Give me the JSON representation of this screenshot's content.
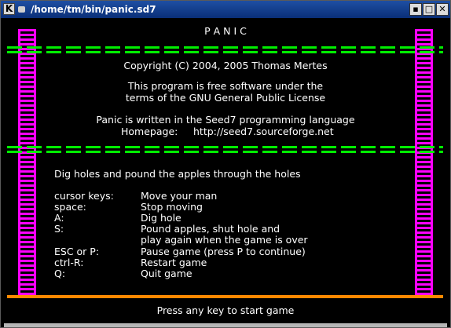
{
  "window": {
    "title": "/home/tm/bin/panic.sd7"
  },
  "icons": {
    "app": "K",
    "min": "▪",
    "max": "□",
    "close": "✕"
  },
  "game": {
    "title": "P A N I C",
    "copyright": "Copyright (C) 2004, 2005  Thomas Mertes",
    "license1": "This program is free software under the",
    "license2": "terms of the GNU General Public License",
    "written": "Panic is written in the Seed7 programming language",
    "homepage_label": "Homepage:",
    "homepage_url": "http://seed7.sourceforge.net",
    "goal": "Dig holes and pound the apples through the holes",
    "controls": [
      {
        "key": "cursor keys:",
        "desc": "Move your man"
      },
      {
        "key": "space:",
        "desc": "Stop moving"
      },
      {
        "key": "A:",
        "desc": "Dig hole"
      },
      {
        "key": "S:",
        "desc": "Pound apples, shut hole and"
      },
      {
        "key": "",
        "desc": "play again when the game is over"
      },
      {
        "key": "ESC or P:",
        "desc": "Pause game (press P to continue)"
      },
      {
        "key": "ctrl-R:",
        "desc": "Restart game"
      },
      {
        "key": "Q:",
        "desc": "Quit game"
      }
    ],
    "prompt": "Press any key to start game"
  },
  "colors": {
    "ladder": "#ff00ff",
    "platform": "#00ee00",
    "ground": "#ff8800",
    "background": "#000000"
  }
}
